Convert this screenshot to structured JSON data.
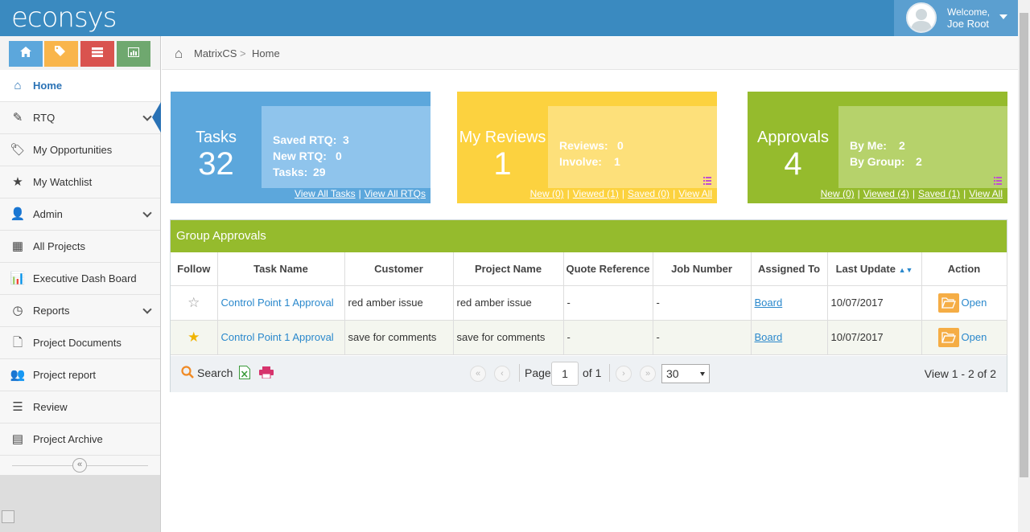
{
  "app": {
    "logo": "econsys",
    "welcome": "Welcome,",
    "user": "Joe Root"
  },
  "breadcrumb": {
    "root": "MatrixCS",
    "separator": ">",
    "current": "Home"
  },
  "sidebar": {
    "items": [
      {
        "label": "Home",
        "icon": "home-icon"
      },
      {
        "label": "RTQ",
        "icon": "edit-icon"
      },
      {
        "label": "My Opportunities",
        "icon": "tags-icon"
      },
      {
        "label": "My Watchlist",
        "icon": "star-icon"
      },
      {
        "label": "Admin",
        "icon": "user-icon"
      },
      {
        "label": "All Projects",
        "icon": "grid-icon"
      },
      {
        "label": "Executive Dash Board",
        "icon": "bar-chart-icon"
      },
      {
        "label": "Reports",
        "icon": "clock-icon"
      },
      {
        "label": "Project Documents",
        "icon": "document-icon"
      },
      {
        "label": "Project report",
        "icon": "users-icon"
      },
      {
        "label": "Review",
        "icon": "list-icon"
      },
      {
        "label": "Project Archive",
        "icon": "archive-icon"
      }
    ],
    "collapse": "«"
  },
  "cards": {
    "tasks": {
      "label": "Tasks",
      "count": "32",
      "l1": "Saved RTQ:",
      "v1": "3",
      "l2": "New RTQ:",
      "v2": "0",
      "l3": "Tasks:",
      "v3": "29",
      "link1": "View All Tasks",
      "link2": "View All RTQs",
      "sep": "|"
    },
    "reviews": {
      "label": "My Reviews",
      "count": "1",
      "l1": "Reviews:",
      "v1": "0",
      "l2": "Involve:",
      "v2": "1",
      "link1": "New (0)",
      "link2": "Viewed (1)",
      "link3": "Saved (0)",
      "link4": "View All",
      "sep": "|"
    },
    "approvals": {
      "label": "Approvals",
      "count": "4",
      "l1": "By Me:",
      "v1": "2",
      "l2": "By Group:",
      "v2": "2",
      "link1": "New (0)",
      "link2": "Viewed (4)",
      "link3": "Saved (1)",
      "link4": "View All",
      "sep": "|"
    }
  },
  "panel": {
    "title": "Group Approvals",
    "columns": [
      "Follow",
      "Task Name",
      "Customer",
      "Project Name",
      "Quote Reference",
      "Job Number",
      "Assigned To",
      "Last Update",
      "Action"
    ],
    "rows": [
      {
        "task": "Control Point 1 Approval",
        "customer": "red amber issue",
        "project": "red amber issue",
        "quote": "-",
        "job": "-",
        "assigned": "Board",
        "updated": "10/07/2017",
        "action": "Open",
        "followed": false
      },
      {
        "task": "Control Point 1 Approval",
        "customer": "save for comments",
        "project": "save for comments",
        "quote": "-",
        "job": "-",
        "assigned": "Board",
        "updated": "10/07/2017",
        "action": "Open",
        "followed": true
      }
    ]
  },
  "pager": {
    "search": "Search",
    "page_label": "Page",
    "page": "1",
    "of": "of 1",
    "per_page": "30",
    "view": "View 1 - 2 of 2"
  },
  "colors": {
    "topbar": "#3a8ac0",
    "tasks": "#5ca7dc",
    "reviews": "#fcd23f",
    "approvals": "#95bb2d"
  }
}
